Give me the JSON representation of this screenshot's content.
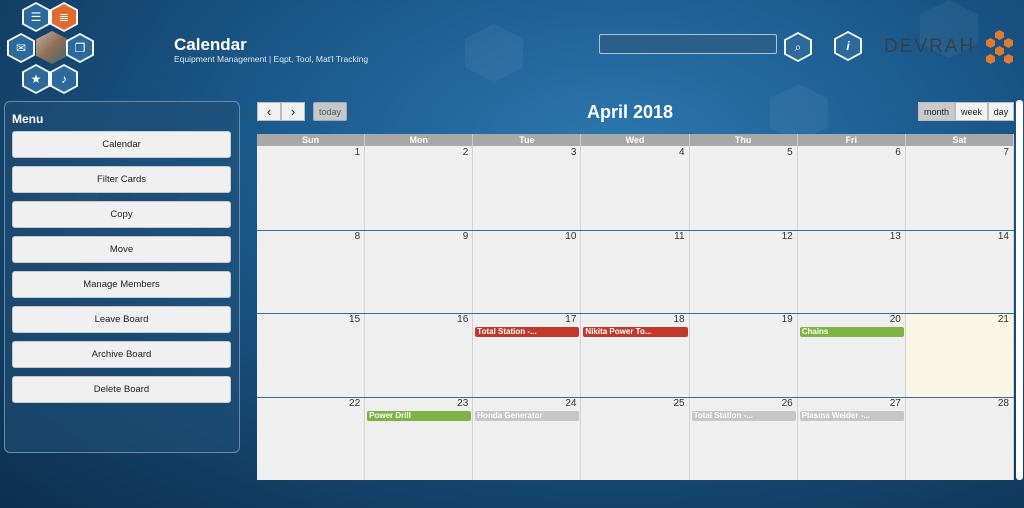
{
  "header": {
    "title": "Calendar",
    "subtitle": "Equipment Management | Eqpt, Tool, Mat'l Tracking",
    "search_placeholder": "",
    "info_icon": "info-icon",
    "logo_text": "DEVRAH",
    "nav_icons": [
      "list-icon",
      "cards-icon",
      "mail-icon",
      "avatar",
      "cards-stack-icon",
      "star-icon",
      "bell-icon"
    ]
  },
  "menu": {
    "title": "Menu",
    "items": [
      "Calendar",
      "Filter Cards",
      "Copy",
      "Move",
      "Manage Members",
      "Leave Board",
      "Archive Board",
      "Delete Board"
    ]
  },
  "calendar": {
    "month_title": "April 2018",
    "today_label": "today",
    "prev_label": "‹",
    "next_label": "›",
    "views": [
      "month",
      "week",
      "day"
    ],
    "active_view": "month",
    "weekdays": [
      "Sun",
      "Mon",
      "Tue",
      "Wed",
      "Thu",
      "Fri",
      "Sat"
    ],
    "weeks": [
      [
        "1",
        "2",
        "3",
        "4",
        "5",
        "6",
        "7"
      ],
      [
        "8",
        "9",
        "10",
        "11",
        "12",
        "13",
        "14"
      ],
      [
        "15",
        "16",
        "17",
        "18",
        "19",
        "20",
        "21"
      ],
      [
        "22",
        "23",
        "24",
        "25",
        "26",
        "27",
        "28"
      ]
    ],
    "today_date": "21",
    "events": [
      {
        "title": "Total Station -...",
        "day": "17",
        "color": "#c0392b"
      },
      {
        "title": "Nikita Power To...",
        "day": "18",
        "color": "#c0392b"
      },
      {
        "title": "Chains",
        "day": "20",
        "color": "#7cb342"
      },
      {
        "title": "Power Drill",
        "day": "23",
        "color": "#7cb342"
      },
      {
        "title": "Honda Generator",
        "day": "24",
        "color": "#c6c6c6"
      },
      {
        "title": "Total Station -...",
        "day": "26",
        "color": "#c6c6c6"
      },
      {
        "title": "Plasma Welder -...",
        "day": "27",
        "color": "#c6c6c6"
      }
    ]
  },
  "colors": {
    "accent": "#e07a2f",
    "nav_blue": "#2c6a9c",
    "event_red": "#c0392b",
    "event_green": "#7cb342",
    "event_gray": "#c6c6c6"
  }
}
